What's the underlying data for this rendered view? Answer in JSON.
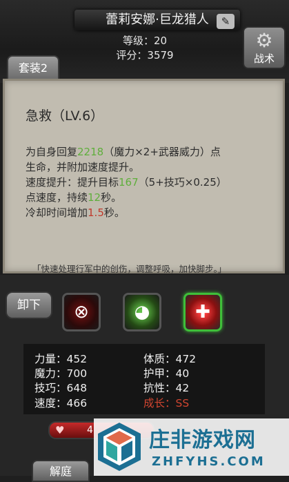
{
  "header": {
    "character_name": "蕾莉安娜·巨龙猎人",
    "level": "等级：20",
    "score": "评分：3579",
    "set_tab": "套装2",
    "tactics": "战术"
  },
  "tooltip": {
    "title": "急救（LV.6）",
    "line1_pre": "为自身回复",
    "heal_value": "2218",
    "line1_post": "（魔力×2+武器威力）点",
    "line2": "生命，并附加速度提升。",
    "line3_pre": "速度提升：提升目标",
    "speed_value": "167",
    "line3_post": "（5+技巧×0.25）",
    "line4_pre": "点速度，持续",
    "duration_value": "12",
    "line4_post": "秒。",
    "line5_pre": "冷却时间增加",
    "cooldown_value": "1.5",
    "line5_post": "秒。",
    "flavor": "「快速处理行军中的创伤，调整呼吸，加快脚步。」"
  },
  "actions": {
    "unequip": "卸下",
    "unlock": "解庭"
  },
  "stats": {
    "strength": "力量：452",
    "magic": "魔力：700",
    "skill": "技巧：648",
    "speed": "速度：466",
    "constitution": "体质：472",
    "armor": "护甲：40",
    "resistance": "抗性：42",
    "growth": "成长：SS"
  },
  "hp_bar": {
    "value": "4"
  },
  "watermark": {
    "title": "庄非游戏网",
    "domain": "ZHFYHS.COM"
  },
  "colors": {
    "highlight_green": "#5fae3c",
    "highlight_red": "#c0392b",
    "growth_red": "#d04530",
    "tooltip_bg": "#c1bcb0",
    "watermark_blue": "#1c6f93"
  }
}
